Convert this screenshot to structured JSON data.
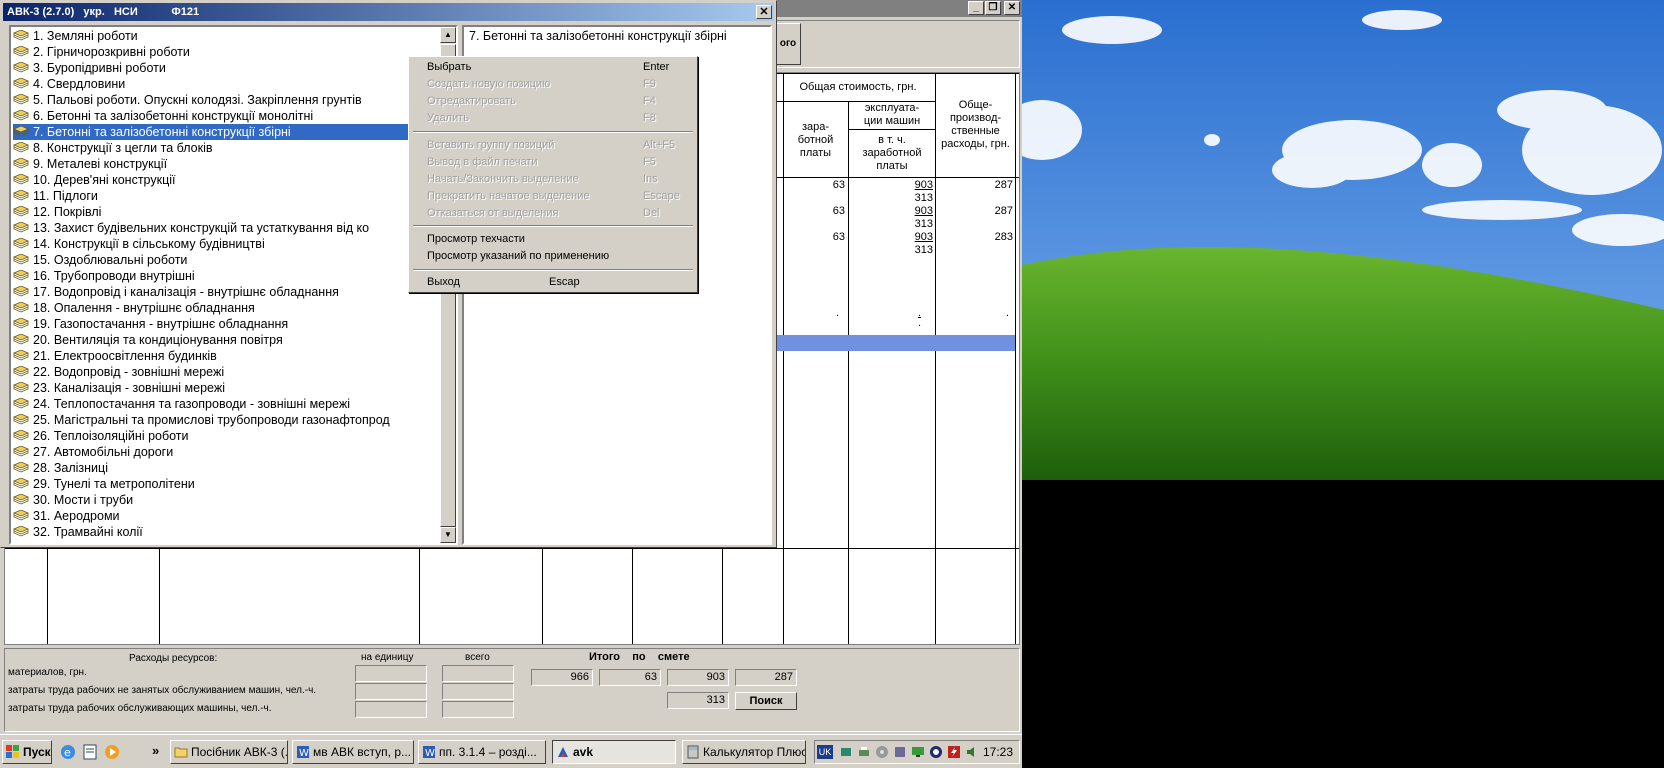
{
  "dialog": {
    "title": "АВК-3 (2.7.0)   укр.   НСИ           Ф121",
    "close": "✕"
  },
  "tree": {
    "items": [
      "1. Земляні роботи",
      "2. Гірничорозкривні роботи",
      "3. Буропідривні роботи",
      "4. Свердловини",
      "5. Пальові роботи. Опускні колодязі. Закріплення грунтів",
      "6. Бетонні та залізобетонні конструкції монолітні",
      "7. Бетонні та залізобетонні конструкції збірні",
      "8. Конструкції з цегли та блоків",
      "9. Металеві конструкції",
      "10. Дерев'яні конструкції",
      "11. Підлоги",
      "12. Покрівлі",
      "13. Захист будівельних конструкцій та устаткування від ко",
      "14. Конструкції в сільському будівництві",
      "15. Оздоблювальні роботи",
      "16. Трубопроводи внутрішні",
      "17. Водопровід і каналізація - внутрішнє обладнання",
      "18. Опалення - внутрішнє обладнання",
      "19. Газопостачання - внутрішнє обладнання",
      "20. Вентиляція та кондиціонування повітря",
      "21. Електроосвітлення будинків",
      "22. Водопровід - зовнішні мережі",
      "23. Каналізація - зовнішні мережі",
      "24. Теплопостачання та газопроводи - зовнішні мережі",
      "25. Магістральні та промислові трубопроводи газонафтопрод",
      "26. Теплоізоляційні роботи",
      "27. Автомобільні дороги",
      "28. Залізниці",
      "29. Тунелі та метрополітени",
      "30. Мости і труби",
      "31. Аеродроми",
      "32. Трамвайні колії"
    ],
    "selected_index": 6
  },
  "detail": {
    "title": "7. Бетонні та залізобетонні конструкції збірні"
  },
  "context_menu": {
    "items": [
      {
        "label": "Выбрать",
        "shortcut": "Enter",
        "enabled": true
      },
      {
        "label": "Создать новую позицию",
        "shortcut": "F9",
        "enabled": false
      },
      {
        "label": "Отредактировать",
        "shortcut": "F4",
        "enabled": false
      },
      {
        "label": "Удалить",
        "shortcut": "F8",
        "enabled": false
      },
      {
        "label": "Вставить группу позиций",
        "shortcut": "Alt+F5",
        "enabled": false
      },
      {
        "label": "Вывод в файл печати",
        "shortcut": "F5",
        "enabled": false
      },
      {
        "label": "Начать/Закончить выделение",
        "shortcut": "Ins",
        "enabled": false
      },
      {
        "label": "Прекратить начатое выделение",
        "shortcut": "Escape",
        "enabled": false
      },
      {
        "label": "Отказаться от выделения",
        "shortcut": "Del",
        "enabled": false
      },
      {
        "label": "Просмотр техчасти",
        "shortcut": "",
        "enabled": true
      },
      {
        "label": "Просмотр указаний по применению",
        "shortcut": "",
        "enabled": true
      },
      {
        "label": "Выход",
        "shortcut": "Escap",
        "enabled": true
      }
    ]
  },
  "main": {
    "top_button_fragment": "ого",
    "table_headers": {
      "total_cost": "Общая стоимость, грн.",
      "wages": "зара-\nботной\nплаты",
      "machine_ops": "эксплуата-\nции машин",
      "incl_wages": "в т. ч.\nзаработной\nплаты",
      "overhead": "Обще-\nпроизвод-\nственные\nрасходы, грн."
    },
    "rows": [
      {
        "left_digit": "6",
        "wages": "63",
        "machine": "903",
        "incl": "313",
        "overhead": "287"
      },
      {
        "left_digit": "6",
        "wages": "63",
        "machine": "903",
        "incl": "313",
        "overhead": "287"
      },
      {
        "left_digit": "6",
        "wages": "63",
        "machine": "903",
        "incl": "313",
        "overhead": "283"
      }
    ],
    "dot_row": {
      "wages": ".",
      "machine": ".",
      "incl": ".",
      "overhead": "."
    }
  },
  "bottom": {
    "resources_label": "Расходы ресурсов:",
    "per_unit": "на единицу",
    "total": "всего",
    "itogo": "Итого    по    смете",
    "materials": "материалов, грн.",
    "labor_not_machines": "затраты труда рабочих не занятых обслуживанием машин, чел.-ч.",
    "labor_machines": "затраты труда рабочих обслуживающих машины, чел.-ч.",
    "totals": [
      "966",
      "63",
      "903",
      "287"
    ],
    "machine_labor_total": "313",
    "search_button": "Поиск"
  },
  "taskbar": {
    "start": "Пуск",
    "chevron": "»",
    "tasks": [
      {
        "label": "Посібник АВК-3 (...",
        "icon": "folder-icon",
        "active": false
      },
      {
        "label": "мв АВК вступ, р...",
        "icon": "word-icon",
        "active": false
      },
      {
        "label": "пп. 3.1.4 – розді...",
        "icon": "word-icon",
        "active": false
      },
      {
        "label": "avk",
        "icon": "avk-icon",
        "active": true
      },
      {
        "label": "Калькулятор Плюс",
        "icon": "calculator-icon",
        "active": false
      }
    ],
    "lang": "UK",
    "clock": "17:23"
  },
  "colors": {
    "selection": "#316ac5",
    "title_start": "#0a246a",
    "title_end": "#a6caf0",
    "face": "#d4d0c8"
  }
}
